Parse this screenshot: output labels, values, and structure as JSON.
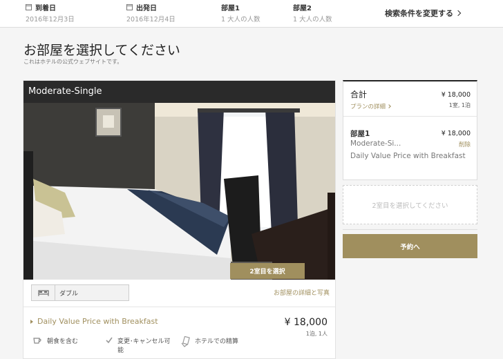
{
  "search_bar": {
    "checkin": {
      "label": "到着日",
      "value": "2016年12月3日",
      "icon": "calendar-icon"
    },
    "checkout": {
      "label": "出発日",
      "value": "2016年12月4日",
      "icon": "calendar-icon"
    },
    "room1": {
      "label": "部屋1",
      "value": "1 大人の人数"
    },
    "room2": {
      "label": "部屋2",
      "value": "1 大人の人数"
    },
    "change_label": "検索条件を変更する"
  },
  "page": {
    "title": "お部屋を選択してください",
    "subtitle": "これはホテルの公式ウェブサイトです。"
  },
  "room": {
    "name": "Moderate-Single",
    "bed_type": "ダブル",
    "detail_link": "お部屋の詳細と写真",
    "plan": {
      "name": "Daily Value Price with Breakfast",
      "price": "¥ 18,000",
      "per": "1泊, 1人",
      "amenities": [
        {
          "icon": "breakfast-icon",
          "label": "朝食を含む"
        },
        {
          "icon": "checkmark-icon",
          "label": "変更･キャンセル可能"
        },
        {
          "icon": "payment-icon",
          "label": "ホテルでの精算"
        }
      ],
      "select_label": "2室目を選択"
    }
  },
  "summary": {
    "total_label": "合計",
    "total_price": "¥ 18,000",
    "total_per": "1室, 1泊",
    "plan_details_link": "プランの詳細",
    "room_label": "部屋1",
    "room_price": "¥ 18,000",
    "room_name": "Moderate-Si...",
    "delete_label": "削除",
    "room_plan": "Daily Value Price with Breakfast",
    "second_room_prompt": "2室目を選択してください",
    "reserve_label": "予約へ"
  },
  "colors": {
    "accent": "#a08f5e",
    "header_dark": "#2a2a2a"
  }
}
